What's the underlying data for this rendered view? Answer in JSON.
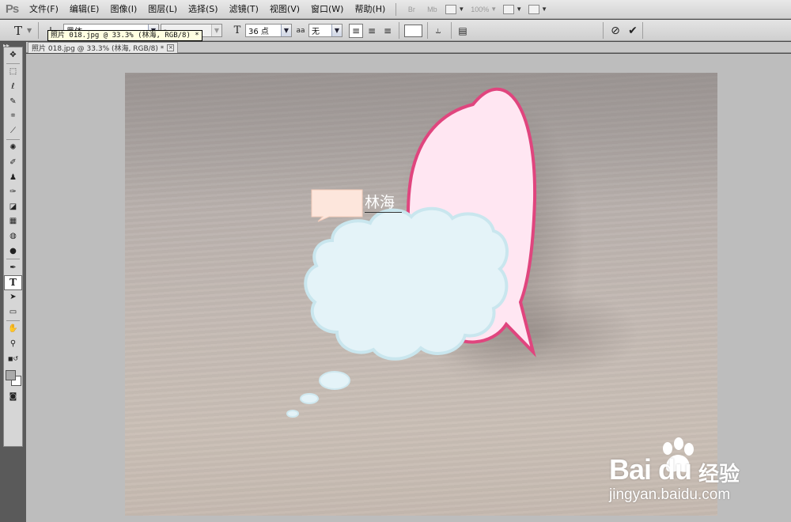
{
  "app": {
    "logo": "Ps"
  },
  "menu": [
    "文件(F)",
    "编辑(E)",
    "图像(I)",
    "图层(L)",
    "选择(S)",
    "滤镜(T)",
    "视图(V)",
    "窗口(W)",
    "帮助(H)"
  ],
  "menubar_controls": {
    "br": "Br",
    "mb": "Mb",
    "zoom": "100%"
  },
  "options": {
    "tool_glyph": "T",
    "font_family": "黑体",
    "font_style": "-",
    "size_glyph": "T",
    "font_size": "36 点",
    "aa_glyph": "aa",
    "antialias": "无"
  },
  "tooltip": "照片 018.jpg @ 33.3% (林海, RGB/8) *",
  "document_tab": {
    "title": "照片 018.jpg @ 33.3% (林海, RGB/8) *",
    "close": "×"
  },
  "canvas_text": "林海",
  "watermark": {
    "logo": "Bai  du",
    "cn": "经验",
    "url": "jingyan.baidu.com"
  },
  "colors": {
    "pink_fill": "#ffe6f2",
    "pink_stroke": "#e0457e",
    "cloud_fill": "#e4f3f8",
    "cloud_stroke": "#c9e6ee",
    "callout_fill": "#fde6dc"
  }
}
